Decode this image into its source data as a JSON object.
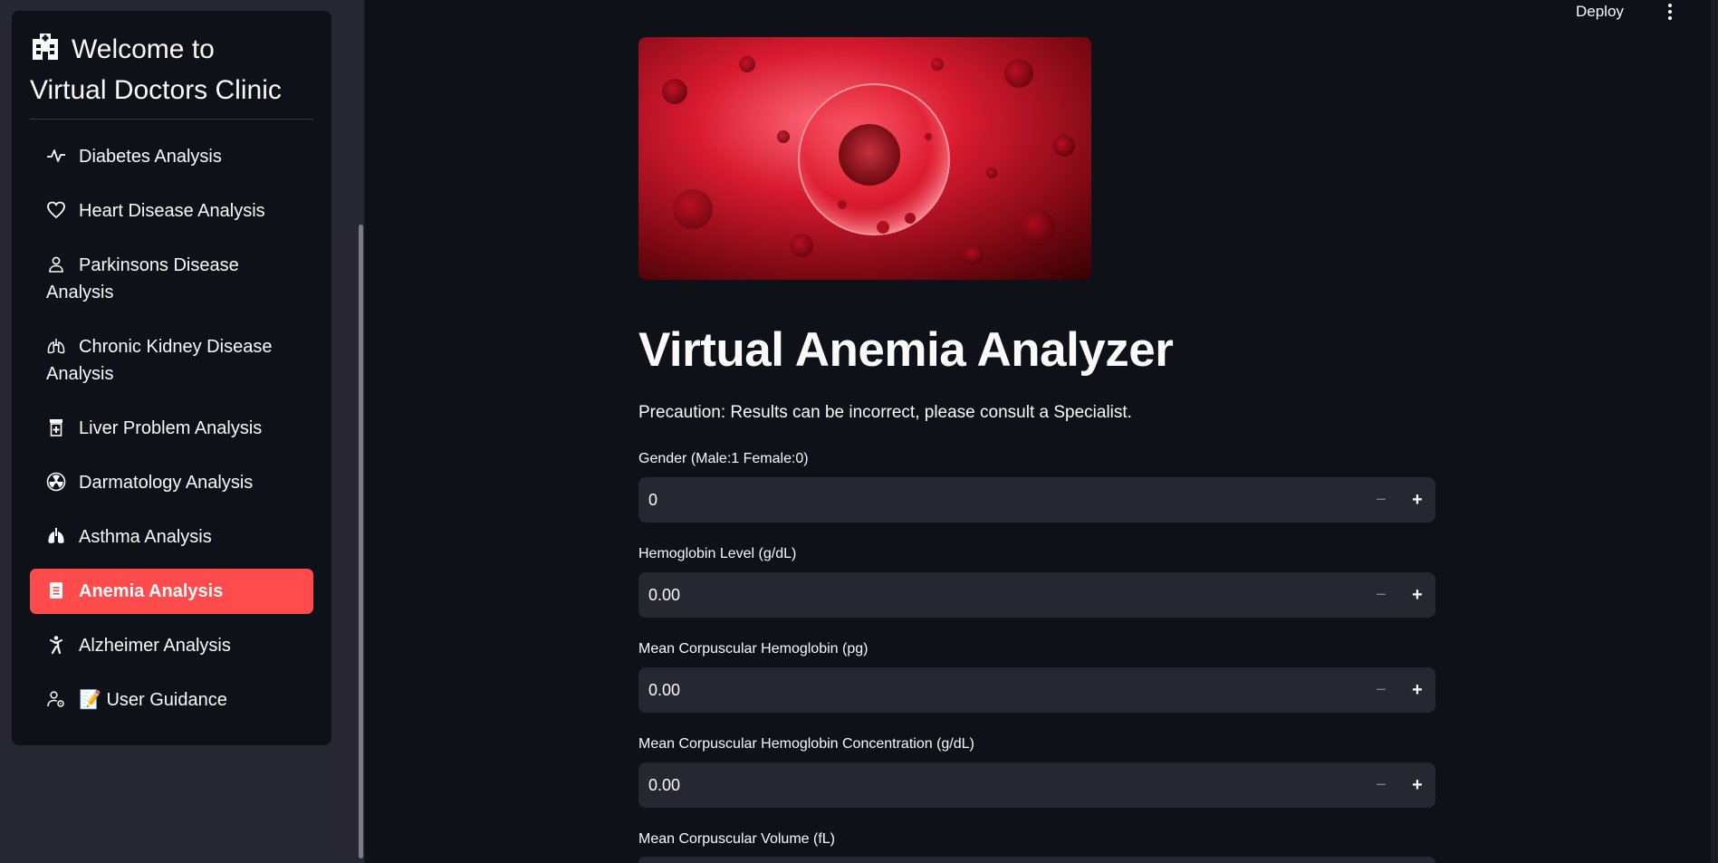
{
  "sidebar": {
    "title_line1": "Welcome to",
    "title_line2": "Virtual Doctors Clinic",
    "items": [
      {
        "label": "Diabetes Analysis",
        "icon": "activity-icon"
      },
      {
        "label": "Heart Disease Analysis",
        "icon": "heart-icon"
      },
      {
        "label": "Parkinsons Disease",
        "label2": "Analysis",
        "icon": "person-icon"
      },
      {
        "label": "Chronic Kidney Disease",
        "label2": "Analysis",
        "icon": "lungs-outline-icon"
      },
      {
        "label": "Liver Problem Analysis",
        "icon": "prescription-bottle-icon"
      },
      {
        "label": "Darmatology Analysis",
        "icon": "radiation-icon"
      },
      {
        "label": "Asthma Analysis",
        "icon": "lungs-icon"
      },
      {
        "label": "Anemia Analysis",
        "icon": "clipboard-icon",
        "active": true
      },
      {
        "label": "Alzheimer Analysis",
        "icon": "person-standing-icon"
      },
      {
        "label": "📝 User Guidance",
        "icon": "person-gear-icon"
      }
    ]
  },
  "header": {
    "deploy_label": "Deploy"
  },
  "main": {
    "title": "Virtual Anemia Analyzer",
    "precaution": "Precaution: Results can be incorrect, please consult a Specialist.",
    "fields": [
      {
        "label": "Gender (Male:1 Female:0)",
        "value": "0"
      },
      {
        "label": "Hemoglobin Level (g/dL)",
        "value": "0.00"
      },
      {
        "label": "Mean Corpuscular Hemoglobin (pg)",
        "value": "0.00"
      },
      {
        "label": "Mean Corpuscular Hemoglobin Concentration (g/dL)",
        "value": "0.00"
      },
      {
        "label": "Mean Corpuscular Volume (fL)",
        "value": ""
      }
    ],
    "stepper_minus": "−",
    "stepper_plus": "+"
  },
  "colors": {
    "accent": "#ff4b4b",
    "background": "#0e1117",
    "sidebar_bg": "#262730",
    "input_bg": "#262730"
  }
}
